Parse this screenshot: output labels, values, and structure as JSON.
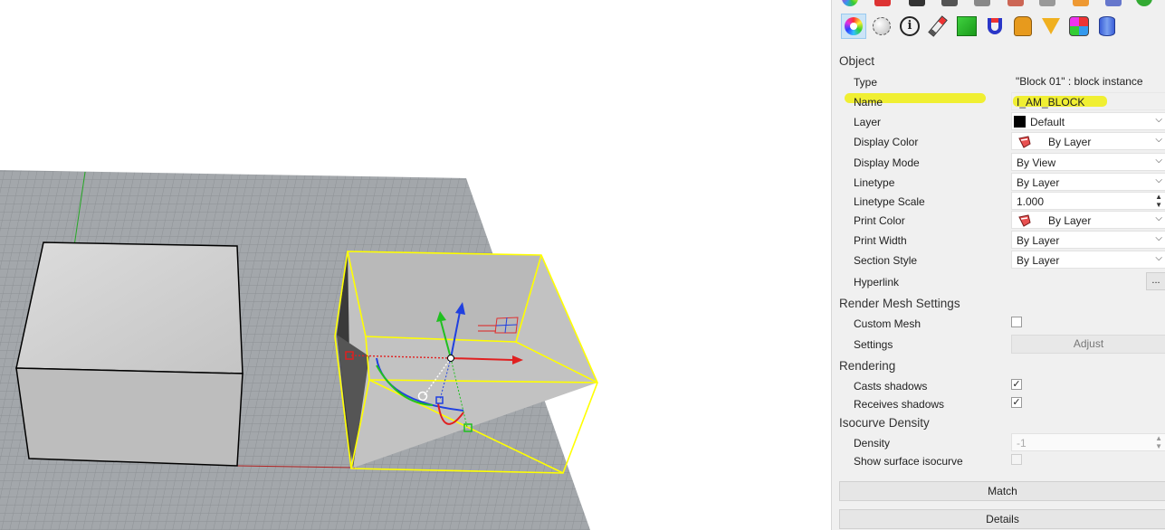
{
  "panel": {
    "sections": {
      "object": "Object",
      "render_mesh": "Render Mesh Settings",
      "rendering": "Rendering",
      "isocurve": "Isocurve Density"
    },
    "object": {
      "type_label": "Type",
      "type_value": "\"Block 01\" : block instance",
      "name_label": "Name",
      "name_value": "I_AM_BLOCK",
      "layer_label": "Layer",
      "layer_value": "Default",
      "display_color_label": "Display Color",
      "display_color_value": "By Layer",
      "display_mode_label": "Display Mode",
      "display_mode_value": "By View",
      "linetype_label": "Linetype",
      "linetype_value": "By Layer",
      "linetype_scale_label": "Linetype Scale",
      "linetype_scale_value": "1.000",
      "print_color_label": "Print Color",
      "print_color_value": "By Layer",
      "print_width_label": "Print Width",
      "print_width_value": "By Layer",
      "section_style_label": "Section Style",
      "section_style_value": "By Layer",
      "hyperlink_label": "Hyperlink",
      "hyperlink_button": "..."
    },
    "render_mesh": {
      "custom_mesh_label": "Custom Mesh",
      "settings_label": "Settings",
      "adjust_button": "Adjust"
    },
    "rendering": {
      "casts_shadows_label": "Casts shadows",
      "casts_shadows_checked": "✓",
      "receives_shadows_label": "Receives shadows",
      "receives_shadows_checked": "✓"
    },
    "isocurve": {
      "density_label": "Density",
      "density_value": "-1",
      "show_surface_label": "Show surface isocurve"
    },
    "match_button": "Match",
    "details_button": "Details"
  },
  "icons": {
    "toolbar": [
      "color-wheel-icon",
      "material-sphere-icon",
      "info-icon",
      "pen-icon",
      "texture-icon",
      "magnet-icon",
      "decal-icon",
      "light-icon",
      "mapping-icon",
      "database-icon"
    ]
  },
  "colors": {
    "highlight": "#f0ee1d",
    "selection": "#ffff00",
    "grid_fill": "#9ea2a6",
    "x_axis": "#e02020",
    "y_axis": "#20c020",
    "z_axis": "#2040e0"
  }
}
